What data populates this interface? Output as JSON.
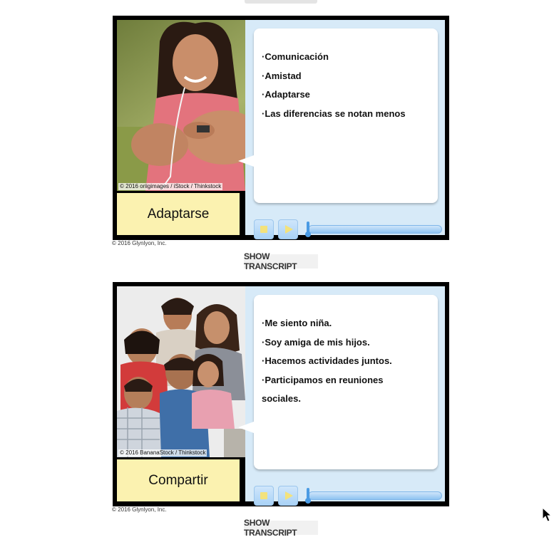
{
  "cards": [
    {
      "photo_credit": "© 2016 oriigimages / iStock / Thinkstock",
      "label": "Adaptarse",
      "bullets": [
        "·Comunicación",
        "·Amistad",
        "·Adaptarse",
        "·Las diferencias se notan menos"
      ],
      "copyright": "© 2016 Glynlyon, Inc.",
      "transcript_button": "SHOW TRANSCRIPT",
      "audio_progress": 0
    },
    {
      "photo_credit": "© 2016 BananaStock / Thinkstock",
      "label": "Compartir",
      "bullets": [
        "·Me siento niña.",
        "·Soy amiga de mis hijos.",
        "·Hacemos actividades juntos.",
        "·Participamos en reuniones sociales."
      ],
      "copyright": "© 2016 Glynlyon, Inc.",
      "transcript_button": "SHOW TRANSCRIPT",
      "audio_progress": 0
    }
  ],
  "icons": {
    "stop": "stop-icon",
    "play": "play-icon",
    "cursor": "mouse-pointer-icon"
  },
  "colors": {
    "label_bg": "#fbf2b0",
    "panel_bg": "#d7eaf8",
    "button_glyph": "#f3e27c",
    "slider": "#4a9be4"
  }
}
